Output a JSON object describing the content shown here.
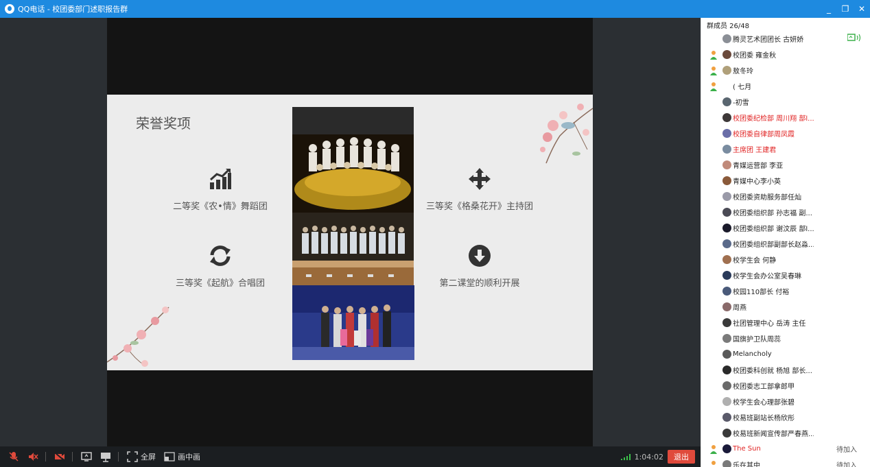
{
  "window": {
    "app_name": "QQ电话",
    "separator": " - ",
    "group_name": "校团委部门述职报告群",
    "minimize_label": "_",
    "restore_label": "❐",
    "close_label": "✕"
  },
  "slide": {
    "title": "荣誉奖项",
    "awards": [
      {
        "label": "二等奖《农•情》舞蹈团",
        "icon": "chart-icon"
      },
      {
        "label": "三等奖《格桑花开》主持团",
        "icon": "move-icon"
      },
      {
        "label": "三等奖《起航》合唱团",
        "icon": "refresh-icon"
      },
      {
        "label": "第二课堂的顺利开展",
        "icon": "cloud-download-icon"
      }
    ]
  },
  "toolbar": {
    "fullscreen_label": "全屏",
    "pip_label": "画中画",
    "duration": "1:04:02",
    "exit_label": "退出"
  },
  "sidebar": {
    "header": "群成员 26/48",
    "members": [
      {
        "name": "腾灵艺术团团长 古妍娇",
        "red": false,
        "speaking": false,
        "aside": "",
        "avatar": "#8b8f96"
      },
      {
        "name": "校团委  雍金秋",
        "red": false,
        "speaking": true,
        "aside": "",
        "avatar": "#6b4a3c"
      },
      {
        "name": "敖冬玲",
        "red": false,
        "speaking": true,
        "aside": "",
        "avatar": "#b0a07a"
      },
      {
        "name": "(    七月",
        "red": false,
        "speaking": true,
        "aside": "",
        "avatar": ""
      },
      {
        "name": "-初雪",
        "red": false,
        "speaking": false,
        "aside": "",
        "avatar": "#5a6670"
      },
      {
        "name": "校团委纪检部 周川翔 部l...",
        "red": true,
        "speaking": false,
        "aside": "",
        "avatar": "#3d3838"
      },
      {
        "name": "校团委自律部周凤霞",
        "red": true,
        "speaking": false,
        "aside": "",
        "avatar": "#6a6ea8"
      },
      {
        "name": "主席团 王建君",
        "red": true,
        "speaking": false,
        "aside": "",
        "avatar": "#7a8ca0"
      },
      {
        "name": "青媒运营部  李亚",
        "red": false,
        "speaking": false,
        "aside": "",
        "avatar": "#c08a7a"
      },
      {
        "name": "青媒中心李小英",
        "red": false,
        "speaking": false,
        "aside": "",
        "avatar": "#8a5a3a"
      },
      {
        "name": "校团委资助服务部任灿",
        "red": false,
        "speaking": false,
        "aside": "",
        "avatar": "#9a9aa8"
      },
      {
        "name": "校团委组织部  孙志福  副...",
        "red": false,
        "speaking": false,
        "aside": "",
        "avatar": "#4a4a55"
      },
      {
        "name": "校团委组织部 谢汶辰 部l...",
        "red": false,
        "speaking": false,
        "aside": "",
        "avatar": "#1a1a2a"
      },
      {
        "name": "校团委组织部副部长赵淼...",
        "red": false,
        "speaking": false,
        "aside": "",
        "avatar": "#5a6a8a"
      },
      {
        "name": "校学生会 何静",
        "red": false,
        "speaking": false,
        "aside": "",
        "avatar": "#a07050"
      },
      {
        "name": "校学生会办公室吴春琳",
        "red": false,
        "speaking": false,
        "aside": "",
        "avatar": "#2a3a5a"
      },
      {
        "name": "校园110部长  付裕",
        "red": false,
        "speaking": false,
        "aside": "",
        "avatar": "#4a5a7a"
      },
      {
        "name": "周燕",
        "red": false,
        "speaking": false,
        "aside": "",
        "avatar": "#8a6a6a"
      },
      {
        "name": "社团管理中心 岳涛 主任",
        "red": false,
        "speaking": false,
        "aside": "",
        "avatar": "#3a3a3a"
      },
      {
        "name": "国旗护卫队周蕊",
        "red": false,
        "speaking": false,
        "aside": "",
        "avatar": "#7a7a7a"
      },
      {
        "name": "Melancholy",
        "red": false,
        "speaking": false,
        "aside": "",
        "avatar": "#5a5a5a"
      },
      {
        "name": "校团委科创就  杨旭  部长...",
        "red": false,
        "speaking": false,
        "aside": "",
        "avatar": "#2a2a2a"
      },
      {
        "name": "校团委志工部拿郎甲",
        "red": false,
        "speaking": false,
        "aside": "",
        "avatar": "#6a6a6a"
      },
      {
        "name": "校学生会心理部张碧",
        "red": false,
        "speaking": false,
        "aside": "",
        "avatar": "#b0b0b0"
      },
      {
        "name": "校易班副站长杨欣彤",
        "red": false,
        "speaking": false,
        "aside": "",
        "avatar": "#5a5a6a"
      },
      {
        "name": "校易班新闻宣传部严春燕...",
        "red": false,
        "speaking": false,
        "aside": "",
        "avatar": "#3a3a3a"
      },
      {
        "name": "The Sun",
        "red": true,
        "speaking": true,
        "aside": "待加入",
        "avatar": "#1a1a3a"
      },
      {
        "name": "乐在其中",
        "red": false,
        "speaking": true,
        "aside": "待加入",
        "avatar": "#7a7a7a"
      }
    ]
  }
}
